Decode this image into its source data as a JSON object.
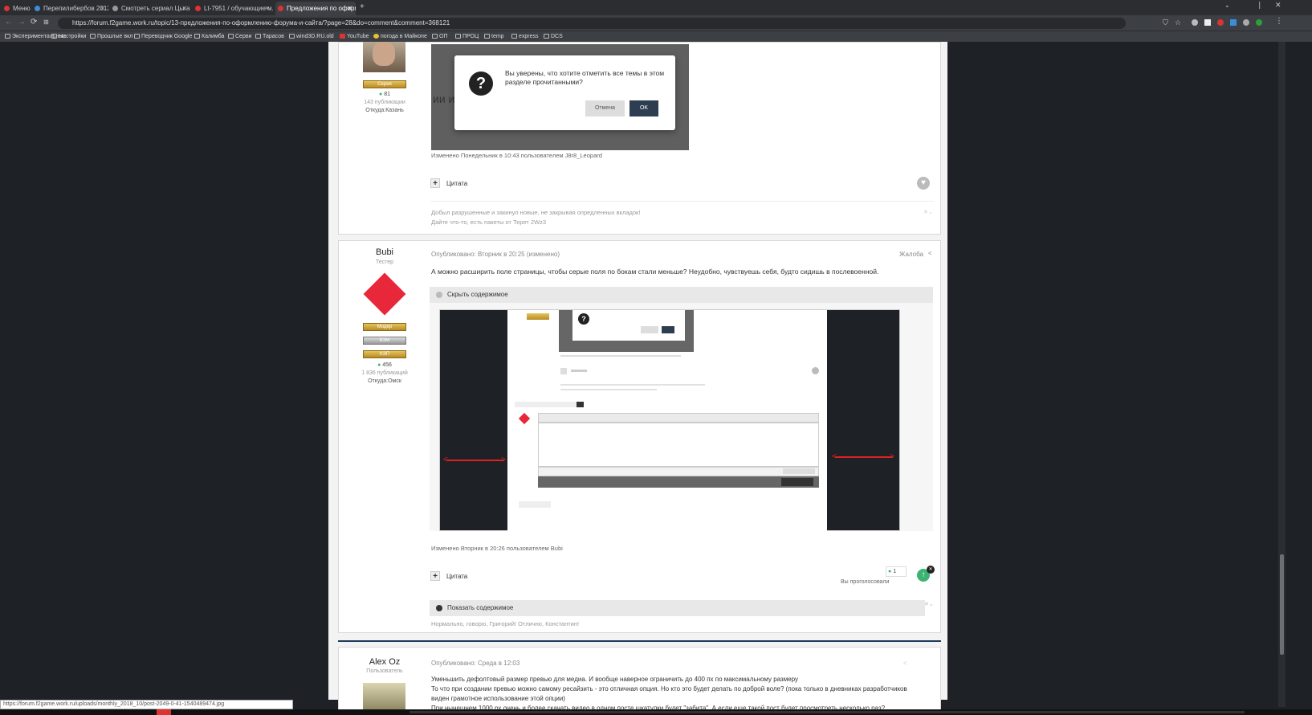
{
  "browser": {
    "tabs": [
      {
        "label": "Меню",
        "color": "#d33"
      },
      {
        "label": "Перепилибербов 2012-й ...",
        "color": "#3a8fd8"
      },
      {
        "label": "Смотреть сериал Цыган...",
        "color": "#999"
      },
      {
        "label": "Lt-7951 / обучающие м...",
        "color": "#d33"
      },
      {
        "label": "Предложения по оформ...",
        "color": "#d33"
      }
    ],
    "new_tab": "+",
    "url": "https://forum.f2game.work.ru/topic/13-предложения-по-оформлению-форума-и-сайта/?page=28&do=comment&comment=368121",
    "bookmarks": [
      "Экспериментальные",
      "Настройки",
      "Прошлые вкл",
      "Переводчик Google",
      "Калимба",
      "Серви",
      "Тарасов",
      "wind3D.RU.old",
      "YouTube",
      "погода в Майкопе",
      "ОП",
      "ПРОЦ",
      "temp",
      "express",
      "DCS"
    ]
  },
  "post1": {
    "author_badge": "Серия",
    "author_rep": "81",
    "author_posts": "143 публикации",
    "author_city": "Откуда:Казань",
    "edited": "Изменено Понедельник в 10:43 пользователем J8r8_Leopard",
    "quote_label": "Цитата",
    "signature_line1": "Добыл разрушенные и закинул новые, не закрывая опредленных вкладок!",
    "signature_line2": "Дайте что-то, есть пакеты от Терет 2Wz3"
  },
  "dialog": {
    "message": "Вы уверены, что хотите отметить все темы в этом разделе прочитанными?",
    "cancel": "Отмена",
    "ok": "OK",
    "bg_text": "ии и"
  },
  "post2": {
    "author": "Bubi",
    "role": "Тестер",
    "badges": [
      "Модер",
      "ВЗМ",
      "КЭП"
    ],
    "rep": "456",
    "posts": "1 836 публикаций",
    "city": "Откуда:Омск",
    "posted": "Опубликовано: Вторник в 20:25 (изменено)",
    "report": "Жалоба",
    "text": "А можно расширить поле страницы, чтобы серые поля по бокам стали меньше? Неудобно, чувствуешь себя, будто сидишь в послевоенной.",
    "spoiler_hide": "Скрыть содержимое",
    "edited": "Изменено Вторник в 20:26 пользователем Bubi",
    "quote_label": "Цитата",
    "like_count": "1",
    "pending": "Вы проголосовали",
    "spoiler_show": "Показать содержимое",
    "signature": "Нормально, говорю, Григорий! Отлично, Константин!"
  },
  "post3": {
    "author": "Alex Oz",
    "role": "Пользователь",
    "posted": "Опубликовано: Среда в 12:03",
    "line1": "Уменьшить дефолтовый размер превью для медиа. И вообще наверное ограничить до 400 пх по максимальному размеру",
    "line2": "То что при создании превью можно самому ресайзить - это отличная опция. Но кто это будет делать по доброй воле? (пока только в дневниках разработчиков",
    "line3": "виден грамотное использование этой опции)",
    "line4": "При нынешнем 1000 px очень и более скачать видео в одном посте шкатулки будет \"забита\". А если еще такой пост будет просмотреть несколько раз?"
  },
  "status_url": "https://forum.f2game.work.ru/uploads/monthly_2018_10/post-2049-0-41-1540489474.jpg",
  "colors": {
    "accent": "#1d3a5a",
    "like": "#3cb371"
  }
}
